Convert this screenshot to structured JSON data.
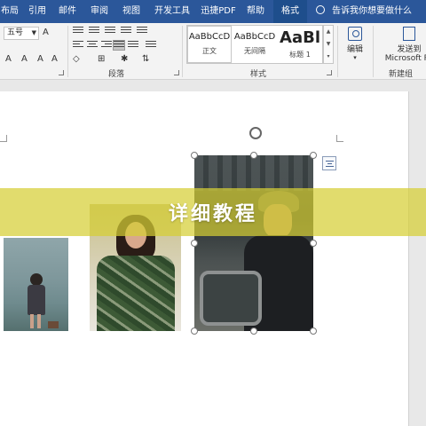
{
  "ribbon_tabs": [
    "布局",
    "引用",
    "邮件",
    "审阅",
    "视图",
    "开发工具",
    "迅捷PDF",
    "帮助",
    "格式"
  ],
  "active_tab": "格式",
  "tell_me": "告诉我你想要做什么",
  "font": {
    "size": "五号"
  },
  "groups": {
    "paragraph": "段落",
    "styles": "样式",
    "new_group": "新建组"
  },
  "styles": [
    {
      "sample": "AaBbCcD",
      "name": "正文"
    },
    {
      "sample": "AaBbCcD",
      "name": "无间隔"
    },
    {
      "sample": "AaBl",
      "name": "标题 1"
    }
  ],
  "editing": {
    "label": "编辑"
  },
  "send": {
    "label_line1": "发送到",
    "label_line2": "Microsoft Po"
  },
  "banner": {
    "text": "详细教程"
  },
  "colors": {
    "ribbon_blue": "#2b579a",
    "banner_yellow": "#d6ce34"
  },
  "icons": [
    "lightbulb-icon",
    "rotate-handle-icon",
    "layout-options-icon",
    "find-icon",
    "send-icon"
  ]
}
